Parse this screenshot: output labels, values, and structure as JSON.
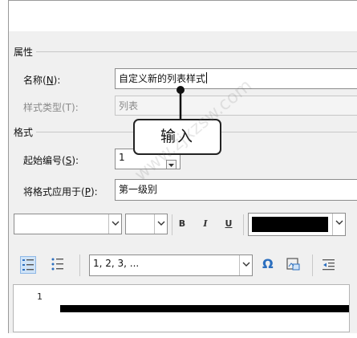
{
  "sections": {
    "properties": "属性",
    "format": "格式"
  },
  "name": {
    "label_prefix": "名称(",
    "label_key": "N",
    "label_suffix": "):",
    "value": "自定义新的列表样式"
  },
  "style_type": {
    "label": "样式类型(T):",
    "value": "列表"
  },
  "start_number": {
    "label_prefix": "起始编号(",
    "label_key": "S",
    "label_suffix": "):",
    "value": "1"
  },
  "apply_to": {
    "label_prefix": "将格式应用于(",
    "label_key": "P",
    "label_suffix": "):",
    "value": "第一级别"
  },
  "toolbar": {
    "bold": "B",
    "italic": "I",
    "underline": "U",
    "font_color": "#000000"
  },
  "numbering": {
    "value": "1, 2, 3, ...",
    "symbol": "Ω"
  },
  "preview": {
    "first_number": "1"
  },
  "callout": {
    "text": "输入"
  },
  "watermark": "www.zjxzsw.com"
}
